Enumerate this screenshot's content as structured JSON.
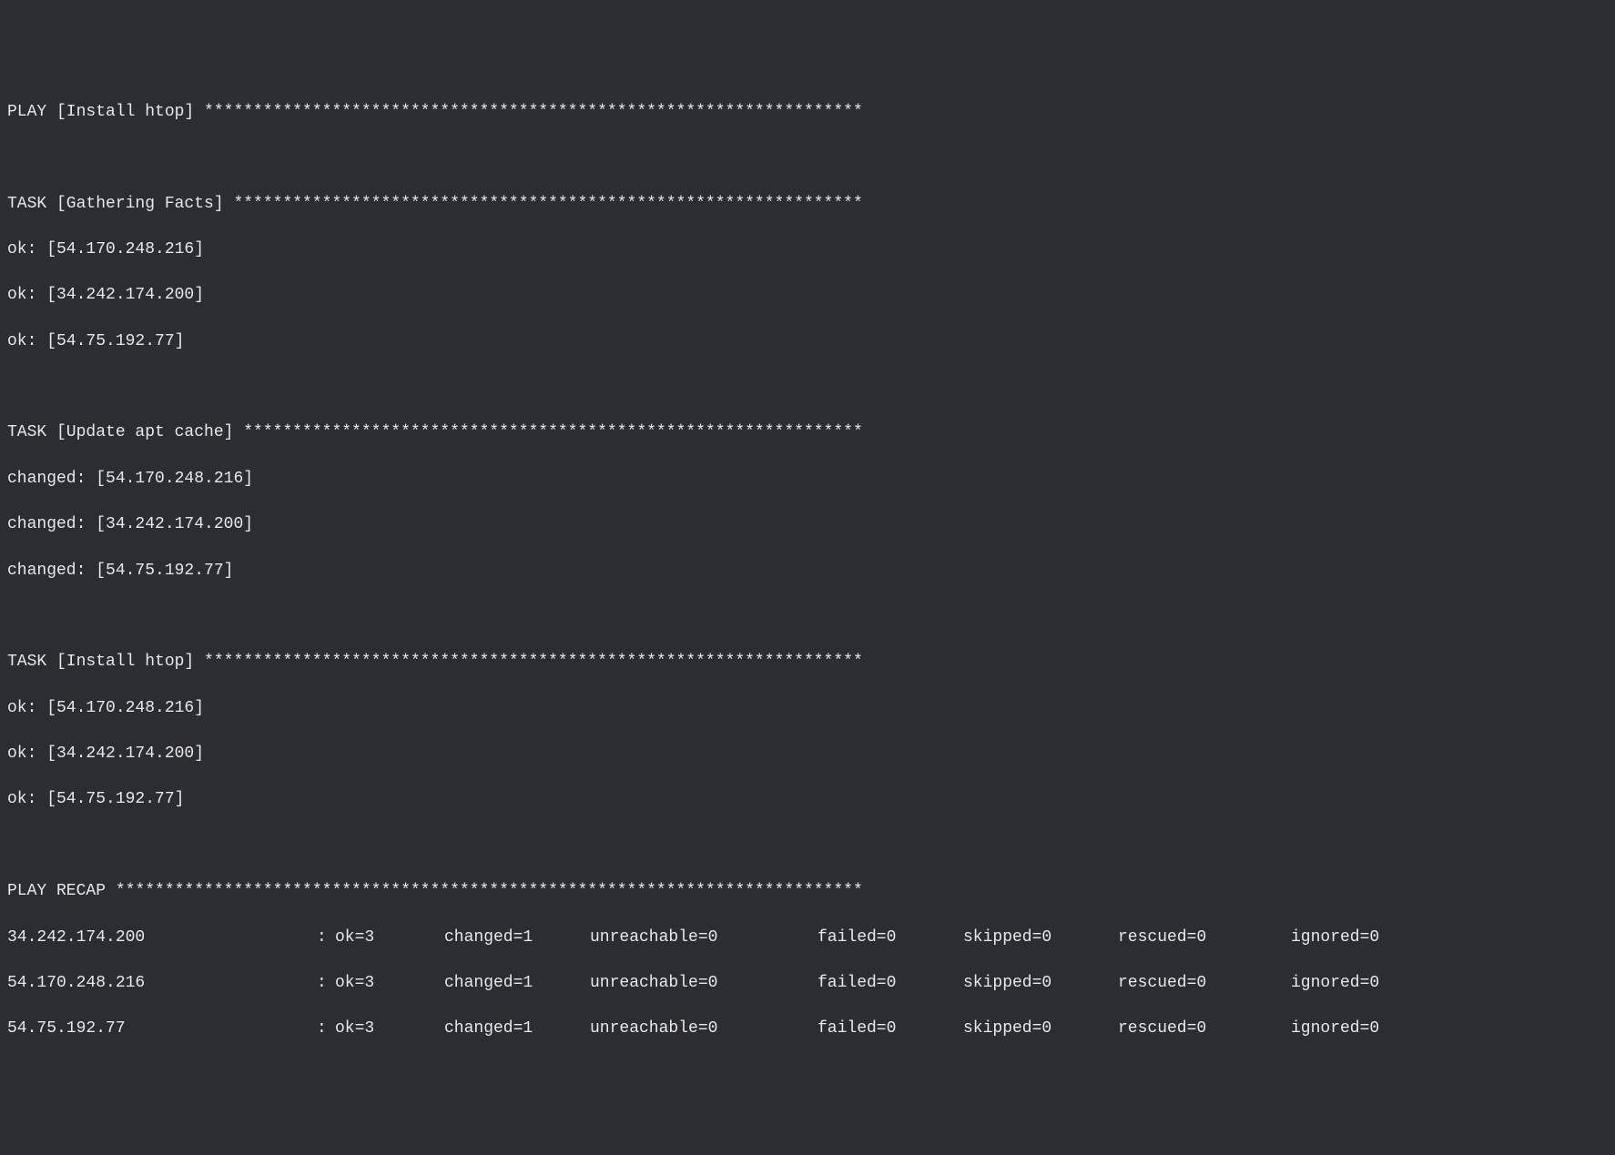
{
  "play": {
    "header": "PLAY [Install htop] *******************************************************************"
  },
  "tasks": [
    {
      "header": "TASK [Gathering Facts] ****************************************************************",
      "results": [
        "ok: [54.170.248.216]",
        "ok: [34.242.174.200]",
        "ok: [54.75.192.77]"
      ]
    },
    {
      "header": "TASK [Update apt cache] ***************************************************************",
      "results": [
        "changed: [54.170.248.216]",
        "changed: [34.242.174.200]",
        "changed: [54.75.192.77]"
      ]
    },
    {
      "header": "TASK [Install htop] *******************************************************************",
      "results": [
        "ok: [54.170.248.216]",
        "ok: [34.242.174.200]",
        "ok: [54.75.192.77]"
      ]
    }
  ],
  "recap": {
    "header": "PLAY RECAP ****************************************************************************",
    "rows": [
      {
        "host": "34.242.174.200",
        "sep": ":",
        "ok": "ok=3",
        "changed": "changed=1",
        "unreachable": "unreachable=0",
        "failed": "failed=0",
        "skipped": "skipped=0",
        "rescued": "rescued=0",
        "ignored": "ignored=0"
      },
      {
        "host": "54.170.248.216",
        "sep": ":",
        "ok": "ok=3",
        "changed": "changed=1",
        "unreachable": "unreachable=0",
        "failed": "failed=0",
        "skipped": "skipped=0",
        "rescued": "rescued=0",
        "ignored": "ignored=0"
      },
      {
        "host": "54.75.192.77",
        "sep": ":",
        "ok": "ok=3",
        "changed": "changed=1",
        "unreachable": "unreachable=0",
        "failed": "failed=0",
        "skipped": "skipped=0",
        "rescued": "rescued=0",
        "ignored": "ignored=0"
      }
    ]
  }
}
